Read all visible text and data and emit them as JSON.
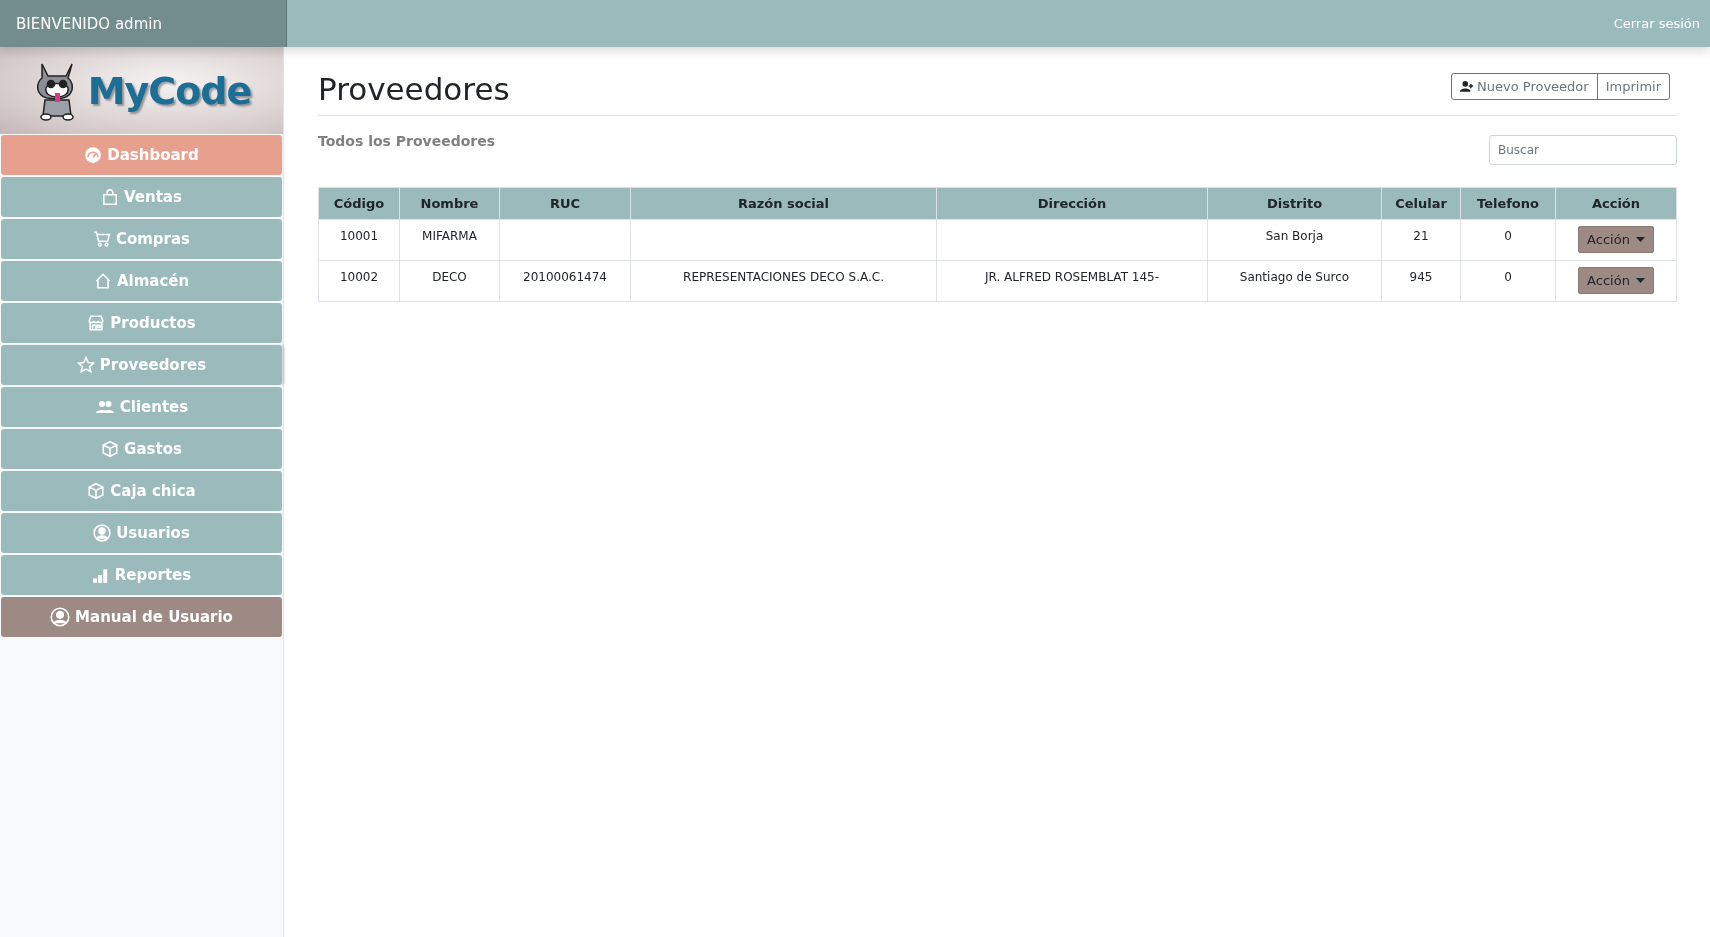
{
  "topbar": {
    "welcome": "BIENVENIDO admin",
    "logout": "Cerrar sesión"
  },
  "sidebar": {
    "logo_text": "MyCode",
    "items": [
      {
        "label": "Dashboard",
        "kind": "highlight"
      },
      {
        "label": "Ventas",
        "kind": "default"
      },
      {
        "label": "Compras",
        "kind": "default"
      },
      {
        "label": "Almacén",
        "kind": "default"
      },
      {
        "label": "Productos",
        "kind": "default"
      },
      {
        "label": "Proveedores",
        "kind": "current"
      },
      {
        "label": "Clientes",
        "kind": "default"
      },
      {
        "label": "Gastos",
        "kind": "default"
      },
      {
        "label": "Caja chica",
        "kind": "default"
      },
      {
        "label": "Usuarios",
        "kind": "default"
      },
      {
        "label": "Reportes",
        "kind": "default"
      },
      {
        "label": "Manual de Usuario",
        "kind": "manual"
      }
    ]
  },
  "page": {
    "title": "Proveedores",
    "buttons": [
      "Nuevo Proveedor",
      "Imprimir"
    ],
    "subtitle": "Todos los Proveedores",
    "search": {
      "placeholder": "Buscar"
    }
  },
  "table": {
    "columns": [
      "Código",
      "Nombre",
      "RUC",
      "Razón social",
      "Dirección",
      "Distrito",
      "Celular",
      "Telefono",
      "Acción"
    ],
    "rows": [
      {
        "cells": [
          "10001",
          "MIFARMA",
          "",
          "",
          "",
          "San Borja",
          "21",
          "0"
        ],
        "action": "Acción"
      },
      {
        "cells": [
          "10002",
          "DECO",
          "20100061474",
          "REPRESENTACIONES DECO S.A.C.",
          "JR. ALFRED ROSEMBLAT 145-",
          "Santiago de Surco",
          "945",
          "0"
        ],
        "action": "Acción"
      }
    ]
  }
}
